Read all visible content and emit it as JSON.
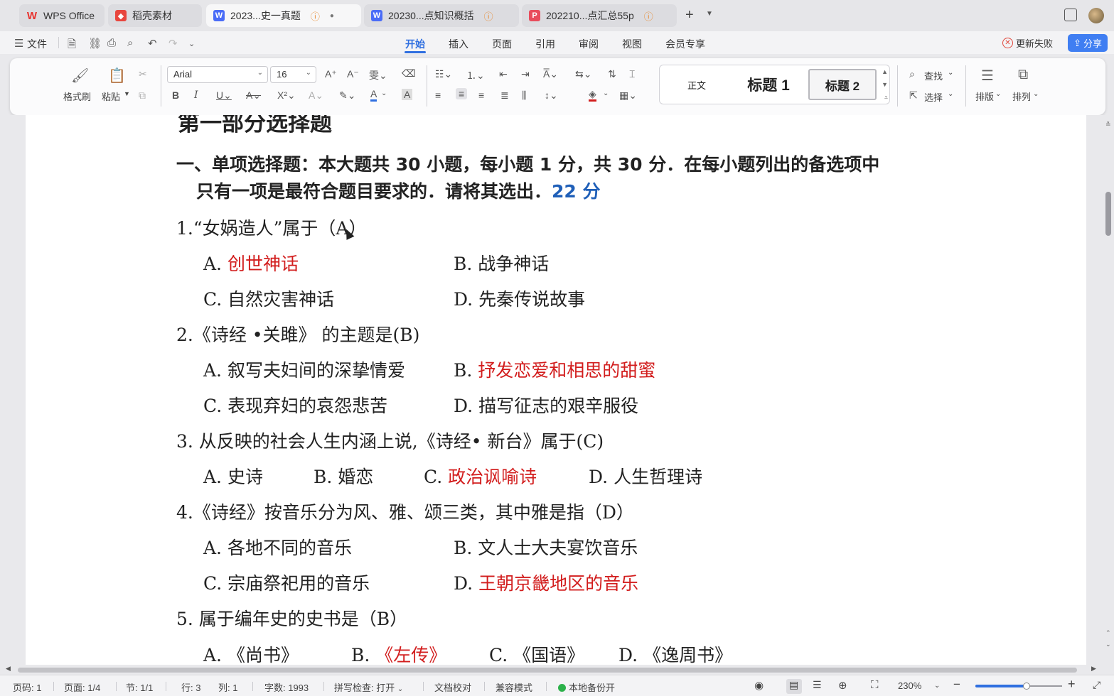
{
  "tabs": [
    {
      "label": "WPS Office",
      "icon": "wps-logo-icon"
    },
    {
      "label": "稻壳素材",
      "icon": "docer-icon"
    },
    {
      "label": "2023...史一真题",
      "icon": "word-doc-icon",
      "active": true
    },
    {
      "label": "20230...点知识概括",
      "icon": "word-doc-icon"
    },
    {
      "label": "202210...点汇总55p",
      "icon": "pdf-icon"
    }
  ],
  "menu": {
    "file": "文件",
    "items": [
      "开始",
      "插入",
      "页面",
      "引用",
      "审阅",
      "视图",
      "会员专享"
    ],
    "active": "开始",
    "update_failed": "更新失败",
    "share": "分享"
  },
  "ribbon": {
    "format_painter": "格式刷",
    "paste": "粘贴",
    "font_name": "Arial",
    "font_size": "16",
    "styles": [
      "正文",
      "标题 1",
      "标题 2"
    ],
    "find": "查找",
    "select": "选择",
    "layout": "排版",
    "arrange": "排列"
  },
  "document": {
    "part_heading": "第一部分选择题",
    "section_line1": "一、单项选择题：本大题共 30 小题，每小题 1 分，共 30 分．在每小题列出的备选项中",
    "section_line2": "只有一项是最符合题目要求的．请将其选出．",
    "section_score": "22 分",
    "questions": [
      {
        "stem": "1.“女娲造人”属于（A）",
        "options": [
          {
            "letter": "A.",
            "text": "创世神话",
            "correct": true
          },
          {
            "letter": "B.",
            "text": "战争神话"
          },
          {
            "letter": "C.",
            "text": "自然灾害神话"
          },
          {
            "letter": "D.",
            "text": "先秦传说故事"
          }
        ]
      },
      {
        "stem": "2.《诗经 •关雎》 的主题是(B)",
        "options": [
          {
            "letter": "A.",
            "text": "叙写夫妇间的深挚情爱"
          },
          {
            "letter": "B.",
            "text": "抒发恋爱和相思的甜蜜",
            "correct": true
          },
          {
            "letter": "C.",
            "text": "表现弃妇的哀怨悲苦"
          },
          {
            "letter": "D.",
            "text": "描写征志的艰辛服役"
          }
        ]
      },
      {
        "stem": "3. 从反映的社会人生内涵上说,《诗经• 新台》属于(C)",
        "options": [
          {
            "letter": "A.",
            "text": "史诗"
          },
          {
            "letter": "B.",
            "text": "婚恋"
          },
          {
            "letter": "C.",
            "text": "政治讽喻诗",
            "correct": true
          },
          {
            "letter": "D.",
            "text": "人生哲理诗"
          }
        ]
      },
      {
        "stem": "4.《诗经》按音乐分为风、雅、颂三类，其中雅是指（D）",
        "options": [
          {
            "letter": "A.",
            "text": "各地不同的音乐"
          },
          {
            "letter": "B.",
            "text": "文人士大夫宴饮音乐"
          },
          {
            "letter": "C.",
            "text": "宗庙祭祀用的音乐"
          },
          {
            "letter": "D.",
            "text": "王朝京畿地区的音乐",
            "correct": true
          }
        ]
      },
      {
        "stem": "5. 属于编年史的史书是（B）",
        "options": [
          {
            "letter": "A.",
            "text": "《尚书》"
          },
          {
            "letter": "B.",
            "text": "《左传》",
            "correct": true
          },
          {
            "letter": "C.",
            "text": "《国语》"
          },
          {
            "letter": "D.",
            "text": "《逸周书》"
          }
        ]
      }
    ]
  },
  "status": {
    "page_code": "页码: 1",
    "page": "页面: 1/4",
    "section": "节: 1/1",
    "row": "行: 3",
    "col": "列: 1",
    "word_count": "字数: 1993",
    "spell_check": "拼写检查: 打开",
    "proofread": "文档校对",
    "compat_mode": "兼容模式",
    "backup": "本地备份开",
    "zoom": "230%"
  },
  "colors": {
    "accent": "#2f6fe0",
    "answer": "#d21d1d",
    "score": "#1f5fb8"
  }
}
